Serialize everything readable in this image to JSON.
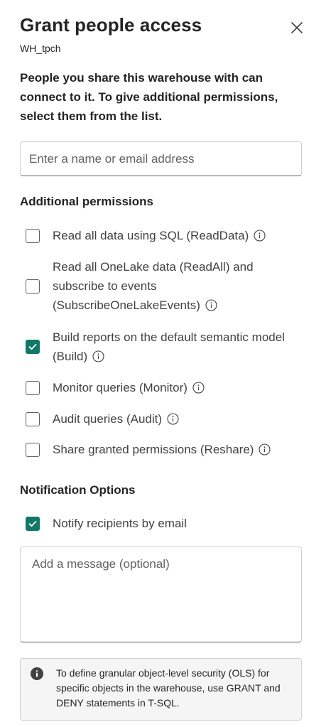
{
  "dialog": {
    "title": "Grant people access",
    "subtitle": "WH_tpch",
    "close_icon": "dismiss-icon",
    "description": "People you share this warehouse with can connect to it. To give additional permissions, select them from the list."
  },
  "search": {
    "placeholder": "Enter a name or email address",
    "value": ""
  },
  "permissions": {
    "heading": "Additional permissions",
    "items": [
      {
        "label": "Read all data using SQL (ReadData)",
        "checked": false
      },
      {
        "label": "Read all OneLake data (ReadAll) and subscribe to events (SubscribeOneLakeEvents)",
        "checked": false
      },
      {
        "label": "Build reports on the default semantic model (Build)",
        "checked": true
      },
      {
        "label": "Monitor queries (Monitor)",
        "checked": false
      },
      {
        "label": "Audit queries (Audit)",
        "checked": false
      },
      {
        "label": "Share granted permissions (Reshare)",
        "checked": false
      }
    ]
  },
  "notification": {
    "heading": "Notification Options",
    "notify_label": "Notify recipients by email",
    "notify_checked": true,
    "message_placeholder": "Add a message (optional)",
    "message_value": ""
  },
  "notice": {
    "icon": "info-filled-icon",
    "text": "To define granular object-level security (OLS) for specific objects in the warehouse, use GRANT and DENY statements in T-SQL."
  },
  "colors": {
    "accent": "#117865",
    "text": "#242424",
    "secondary_text": "#424242",
    "border": "#d1d1d1",
    "notice_bg": "#f5f5f5"
  }
}
